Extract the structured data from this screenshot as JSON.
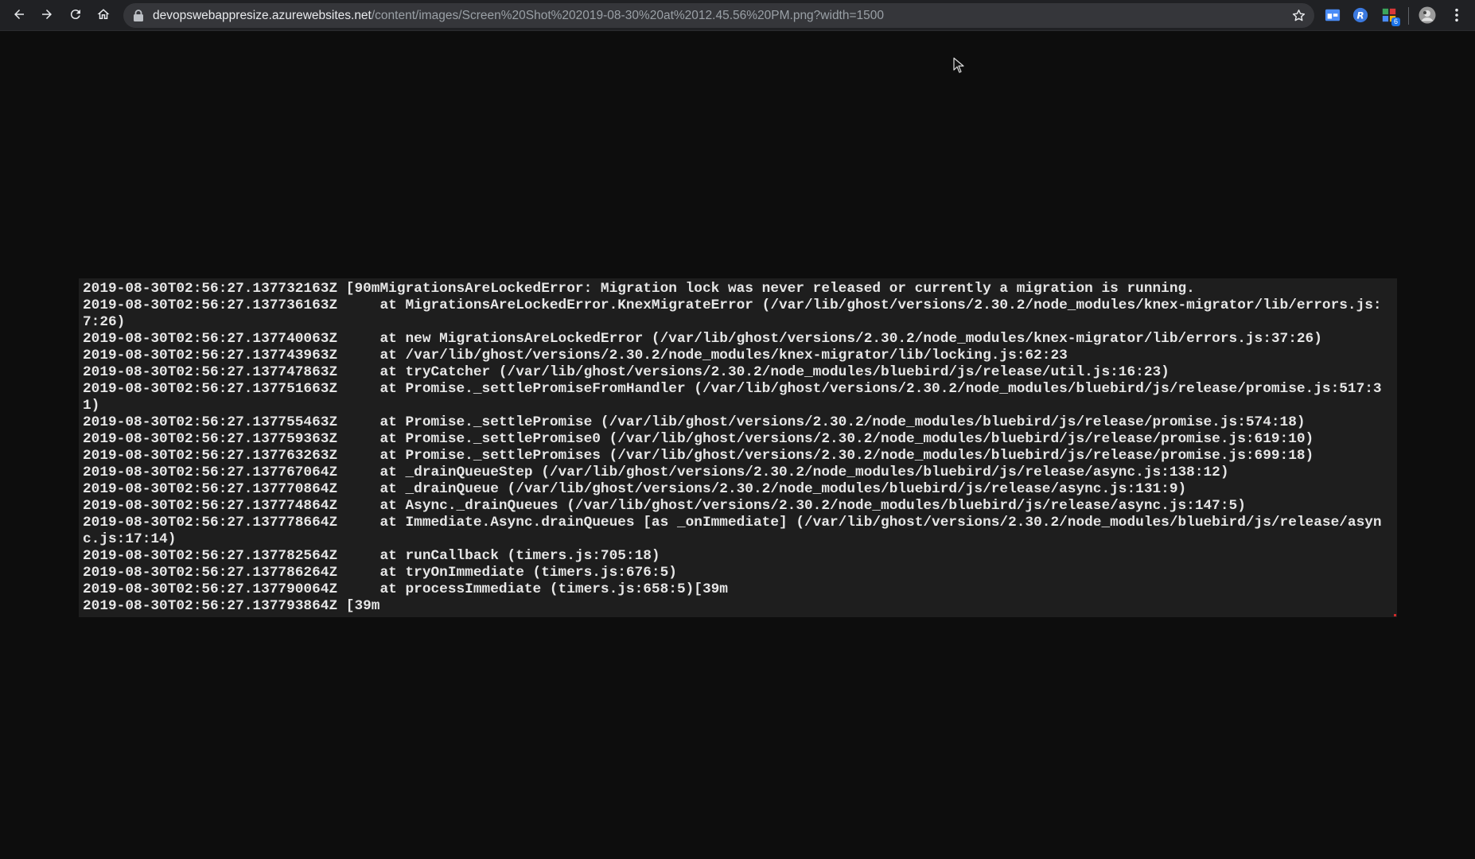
{
  "browser": {
    "url_host": "devopswebappresize.azurewebsites.net",
    "url_path": "/content/images/Screen%20Shot%202019-08-30%20at%2012.45.56%20PM.png?width=1500",
    "extension_badge": "6",
    "icons": {
      "back": "back-arrow-icon",
      "forward": "forward-arrow-icon",
      "reload": "reload-icon",
      "home": "home-icon",
      "lock": "lock-icon",
      "bookmark": "star-icon",
      "menu": "kebab-menu-icon"
    }
  },
  "terminal": {
    "lines": [
      {
        "ts": "2019-08-30T02:56:27.137732163Z",
        "msg": " [90mMigrationsAreLockedError: Migration lock was never released or currently a migration is running."
      },
      {
        "ts": "2019-08-30T02:56:27.137736163Z",
        "msg": "     at MigrationsAreLockedError.KnexMigrateError (/var/lib/ghost/versions/2.30.2/node_modules/knex-migrator/lib/errors.js:7:26)"
      },
      {
        "ts": "2019-08-30T02:56:27.137740063Z",
        "msg": "     at new MigrationsAreLockedError (/var/lib/ghost/versions/2.30.2/node_modules/knex-migrator/lib/errors.js:37:26)"
      },
      {
        "ts": "2019-08-30T02:56:27.137743963Z",
        "msg": "     at /var/lib/ghost/versions/2.30.2/node_modules/knex-migrator/lib/locking.js:62:23"
      },
      {
        "ts": "2019-08-30T02:56:27.137747863Z",
        "msg": "     at tryCatcher (/var/lib/ghost/versions/2.30.2/node_modules/bluebird/js/release/util.js:16:23)"
      },
      {
        "ts": "2019-08-30T02:56:27.137751663Z",
        "msg": "     at Promise._settlePromiseFromHandler (/var/lib/ghost/versions/2.30.2/node_modules/bluebird/js/release/promise.js:517:31)"
      },
      {
        "ts": "2019-08-30T02:56:27.137755463Z",
        "msg": "     at Promise._settlePromise (/var/lib/ghost/versions/2.30.2/node_modules/bluebird/js/release/promise.js:574:18)"
      },
      {
        "ts": "2019-08-30T02:56:27.137759363Z",
        "msg": "     at Promise._settlePromise0 (/var/lib/ghost/versions/2.30.2/node_modules/bluebird/js/release/promise.js:619:10)"
      },
      {
        "ts": "2019-08-30T02:56:27.137763263Z",
        "msg": "     at Promise._settlePromises (/var/lib/ghost/versions/2.30.2/node_modules/bluebird/js/release/promise.js:699:18)"
      },
      {
        "ts": "2019-08-30T02:56:27.137767064Z",
        "msg": "     at _drainQueueStep (/var/lib/ghost/versions/2.30.2/node_modules/bluebird/js/release/async.js:138:12)"
      },
      {
        "ts": "2019-08-30T02:56:27.137770864Z",
        "msg": "     at _drainQueue (/var/lib/ghost/versions/2.30.2/node_modules/bluebird/js/release/async.js:131:9)"
      },
      {
        "ts": "2019-08-30T02:56:27.137774864Z",
        "msg": "     at Async._drainQueues (/var/lib/ghost/versions/2.30.2/node_modules/bluebird/js/release/async.js:147:5)"
      },
      {
        "ts": "2019-08-30T02:56:27.137778664Z",
        "msg": "     at Immediate.Async.drainQueues [as _onImmediate] (/var/lib/ghost/versions/2.30.2/node_modules/bluebird/js/release/async.js:17:14)"
      },
      {
        "ts": "2019-08-30T02:56:27.137782564Z",
        "msg": "     at runCallback (timers.js:705:18)"
      },
      {
        "ts": "2019-08-30T02:56:27.137786264Z",
        "msg": "     at tryOnImmediate (timers.js:676:5)"
      },
      {
        "ts": "2019-08-30T02:56:27.137790064Z",
        "msg": "     at processImmediate (timers.js:658:5)[39m"
      },
      {
        "ts": "2019-08-30T02:56:27.137793864Z",
        "msg": " [39m"
      }
    ]
  }
}
